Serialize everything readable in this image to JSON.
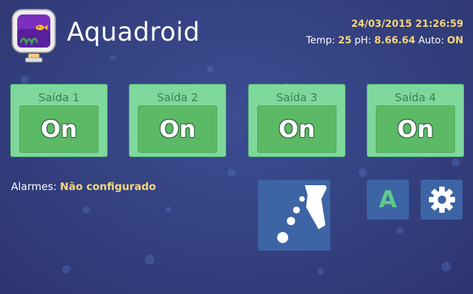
{
  "header": {
    "app_title": "Aquadroid",
    "datetime": "24/03/2015 21:26:59",
    "temp_label": "Temp:",
    "temp_value": "25",
    "ph_label": "pH:",
    "ph_value": "8.66.64",
    "auto_label": "Auto:",
    "auto_value": "ON"
  },
  "outputs": [
    {
      "label": "Saída 1",
      "state": "On"
    },
    {
      "label": "Saída 2",
      "state": "On"
    },
    {
      "label": "Saída 3",
      "state": "On"
    },
    {
      "label": "Saída 4",
      "state": "On"
    }
  ],
  "alarms": {
    "label": "Alarmes:",
    "value": "Não configurado"
  },
  "tiles": {
    "auto_letter": "A",
    "aquarium_icon": "aquarium-bubbles-icon",
    "settings_icon": "gear-icon"
  },
  "colors": {
    "background": "#34407f",
    "card": "#7fd89b",
    "button": "#5cba66",
    "tile": "#3d64a5",
    "highlight": "#f7d778",
    "auto_letter": "#5fc98b"
  }
}
